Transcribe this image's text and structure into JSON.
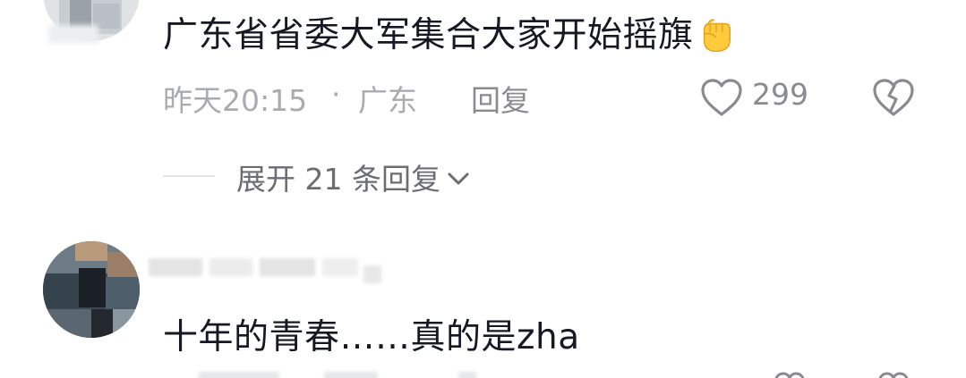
{
  "comments": [
    {
      "text": "广东省省委大军集合大家开始摇旗",
      "emoji": "raised-fist",
      "time": "昨天20:15",
      "separator": "·",
      "location": "广东",
      "reply_label": "回复",
      "like_count": "299",
      "expand_replies_label": "展开 21 条回复"
    },
    {
      "text": "十年的青春……真的是zha"
    }
  ],
  "icons": {
    "like": "heart-outline-icon",
    "dislike": "broken-heart-icon",
    "expand": "chevron-down-icon",
    "emoji": "raised-fist-emoji"
  },
  "colors": {
    "text_primary": "#161823",
    "text_meta": "#a9abb0",
    "text_secondary": "#6b6d73",
    "emoji_yellow": "#ffcb3d"
  }
}
